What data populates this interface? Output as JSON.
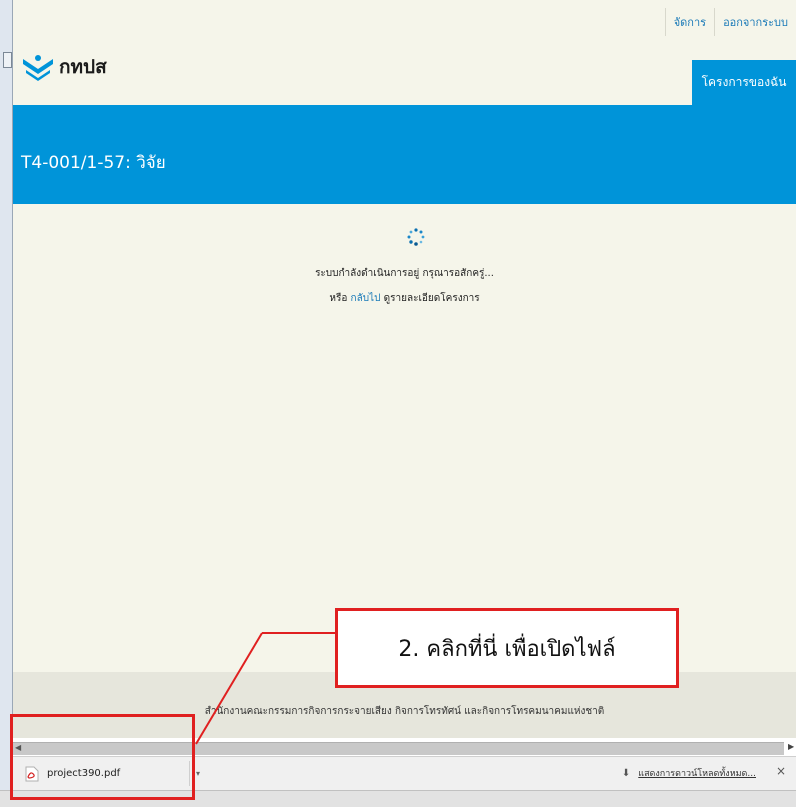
{
  "header": {
    "links": [
      "จัดการ",
      "ออกจากระบบ"
    ],
    "logo_text": "กทปส",
    "my_projects": "โครงการของฉัน"
  },
  "project": {
    "title": "T4-001/1-57: วิจัย"
  },
  "loading": {
    "message": "ระบบกำลังดำเนินการอยู่ กรุณารอสักครู่...",
    "or": "หรือ",
    "back_link": "กลับไป",
    "back_suffix": "ดูรายละเอียดโครงการ"
  },
  "footer": {
    "text": "สำนักงานคณะกรรมการกิจการกระจายเสียง กิจการโทรทัศน์ และกิจการโทรคมนาคมแห่งชาติ"
  },
  "download_bar": {
    "file_name": "project390.pdf",
    "show_all": "แสดงการดาวน์โหลดทั้งหมด...",
    "close": "×"
  },
  "annotation": {
    "callout": "2. คลิกที่นี่ เพื่อเปิดไฟล์"
  },
  "colors": {
    "brand_blue": "#0094d9",
    "page_bg": "#f5f5ea",
    "annotation_red": "#e02020"
  }
}
